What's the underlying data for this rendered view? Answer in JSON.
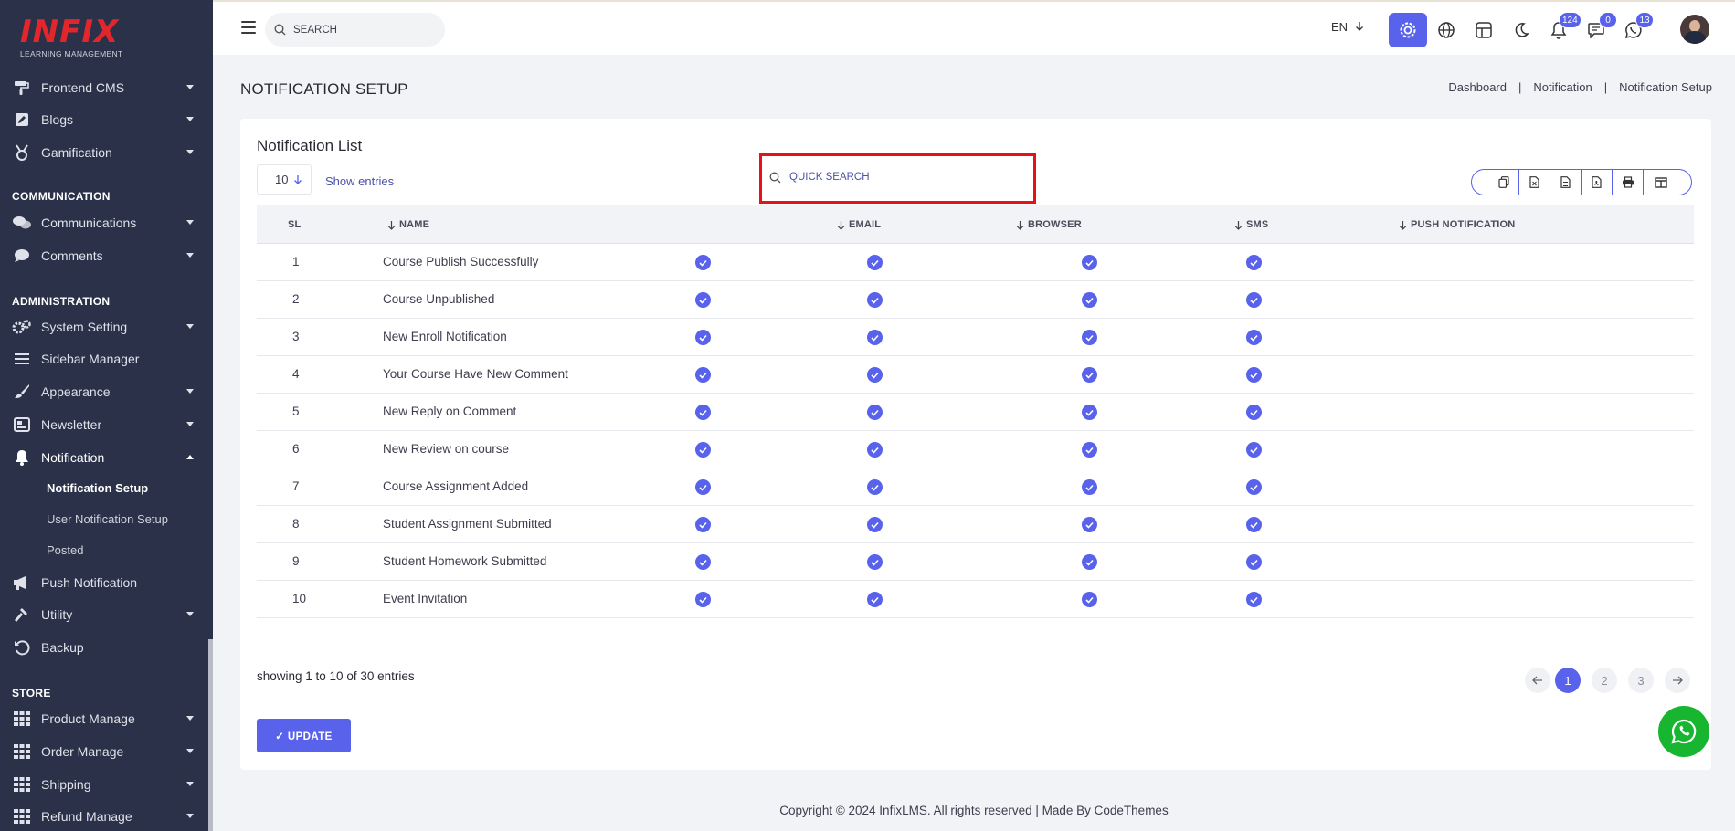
{
  "sidebar": {
    "logo": {
      "mark": "INFIX",
      "sub": "LEARNING MANAGEMENT"
    },
    "items": [
      {
        "label": "Frontend CMS"
      },
      {
        "label": "Blogs"
      },
      {
        "label": "Gamification"
      },
      {
        "label": "Communications"
      },
      {
        "label": "Comments"
      },
      {
        "label": "System Setting"
      },
      {
        "label": "Sidebar Manager"
      },
      {
        "label": "Appearance"
      },
      {
        "label": "Newsletter"
      },
      {
        "label": "Notification"
      },
      {
        "label": "Push Notification"
      },
      {
        "label": "Utility"
      },
      {
        "label": "Backup"
      },
      {
        "label": "Product Manage"
      },
      {
        "label": "Order Manage"
      },
      {
        "label": "Shipping"
      },
      {
        "label": "Refund Manage"
      }
    ],
    "sections": {
      "communication": "COMMUNICATION",
      "administration": "ADMINISTRATION",
      "store": "STORE"
    },
    "notification_sub": [
      "Notification Setup",
      "User Notification Setup",
      "Posted"
    ]
  },
  "topbar": {
    "search_placeholder": "SEARCH",
    "language": "EN",
    "badges": {
      "notifications": "124",
      "messages": "0",
      "whatsapp": "13"
    }
  },
  "page": {
    "title": "NOTIFICATION SETUP",
    "breadcrumb": [
      "Dashboard",
      "Notification",
      "Notification Setup"
    ],
    "breadcrumb_sep": "|"
  },
  "card": {
    "title": "Notification List",
    "page_length": "10",
    "show_entries": "Show entries",
    "quick_search_placeholder": "QUICK SEARCH",
    "columns": [
      "SL",
      "NAME",
      "EMAIL",
      "BROWSER",
      "SMS",
      "PUSH NOTIFICATION"
    ],
    "rows": [
      {
        "sl": "1",
        "name": "Course Publish Successfully"
      },
      {
        "sl": "2",
        "name": "Course Unpublished"
      },
      {
        "sl": "3",
        "name": "New Enroll Notification"
      },
      {
        "sl": "4",
        "name": "Your Course Have New Comment"
      },
      {
        "sl": "5",
        "name": "New Reply on Comment"
      },
      {
        "sl": "6",
        "name": "New Review on course"
      },
      {
        "sl": "7",
        "name": "Course Assignment Added"
      },
      {
        "sl": "8",
        "name": "Student Assignment Submitted"
      },
      {
        "sl": "9",
        "name": "Student Homework Submitted"
      },
      {
        "sl": "10",
        "name": "Event Invitation"
      }
    ],
    "showing": "showing 1 to 10 of 30 entries",
    "pages": [
      "1",
      "2",
      "3"
    ],
    "update_label": "✓ UPDATE"
  },
  "footer": {
    "text": "Copyright © 2024 InfixLMS. All rights reserved | Made By CodeThemes"
  },
  "colors": {
    "primary": "#5862ea",
    "sidebar": "#2b3148",
    "highlight": "#e8101a",
    "whatsapp": "#17b530"
  }
}
